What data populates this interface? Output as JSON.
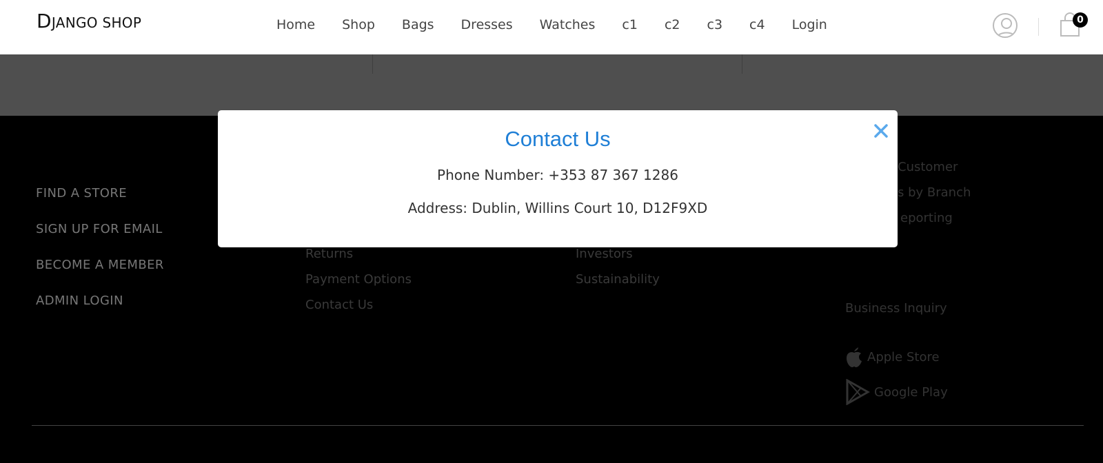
{
  "header": {
    "brand": {
      "initial": "D",
      "rest": "JANGO SHOP"
    },
    "nav": [
      "Home",
      "Shop",
      "Bags",
      "Dresses",
      "Watches",
      "c1",
      "c2",
      "c3",
      "c4",
      "Login"
    ],
    "cart_count": "0"
  },
  "footer": {
    "col1": [
      "FIND A STORE",
      "SIGN UP FOR EMAIL",
      "BECOME A MEMBER",
      "ADMIN LOGIN"
    ],
    "col2": [
      "Returns",
      "Payment Options",
      "Contact Us"
    ],
    "col3": [
      "Investors",
      "Sustainability"
    ],
    "col4": [
      "Customer",
      "s by Branch",
      "eporting",
      "Business Inquiry"
    ],
    "apps": {
      "apple": "Apple Store",
      "google": "Google Play"
    }
  },
  "modal": {
    "title": "Contact Us",
    "phone": "Phone Number: +353 87 367 1286",
    "address": "Address: Dublin, Willins Court 10, D12F9XD"
  },
  "colors": {
    "accent": "#1f7fd6",
    "close": "#5aa9ec"
  }
}
